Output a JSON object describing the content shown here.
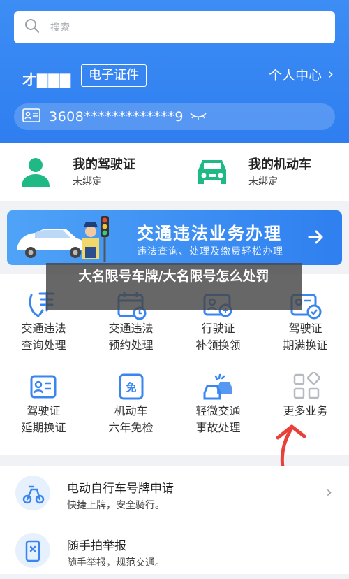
{
  "search": {
    "placeholder": "搜索"
  },
  "user": {
    "name": "才▇▇▇",
    "cert_button": "电子证件",
    "center_link": "个人中心",
    "id_number": "3608*************9"
  },
  "cards": [
    {
      "title": "我的驾驶证",
      "status": "未绑定",
      "icon": "person-icon"
    },
    {
      "title": "我的机动车",
      "status": "未绑定",
      "icon": "car-icon"
    }
  ],
  "banner": {
    "title": "交通违法业务办理",
    "subtitle": "违法查询、处理及缴费轻松办理"
  },
  "grid": [
    {
      "l1": "交通违法",
      "l2": "查询处理",
      "icon": "violation-query-icon"
    },
    {
      "l1": "交通违法",
      "l2": "预约处理",
      "icon": "calendar-icon"
    },
    {
      "l1": "行驶证",
      "l2": "补领换领",
      "icon": "id-card-icon"
    },
    {
      "l1": "驾驶证",
      "l2": "期满换证",
      "icon": "license-renew-icon"
    },
    {
      "l1": "驾驶证",
      "l2": "延期换证",
      "icon": "license-extend-icon"
    },
    {
      "l1": "机动车",
      "l2": "六年免检",
      "icon": "exempt-icon"
    },
    {
      "l1": "轻微交通",
      "l2": "事故处理",
      "icon": "accident-icon"
    },
    {
      "l1": "更多业务",
      "l2": "",
      "icon": "more-grid-icon"
    }
  ],
  "overlay": {
    "text": "大名限号车牌/大名限号怎么处罚"
  },
  "list": [
    {
      "title": "电动自行车号牌申请",
      "subtitle": "快捷上牌，安全骑行。",
      "icon": "ebike-icon"
    },
    {
      "title": "随手拍举报",
      "subtitle": "随手举报，规范交通。",
      "icon": "phone-report-icon"
    }
  ],
  "colors": {
    "primary": "#2f7ef0",
    "green": "#1fb985",
    "red_arrow": "#e8413a"
  }
}
